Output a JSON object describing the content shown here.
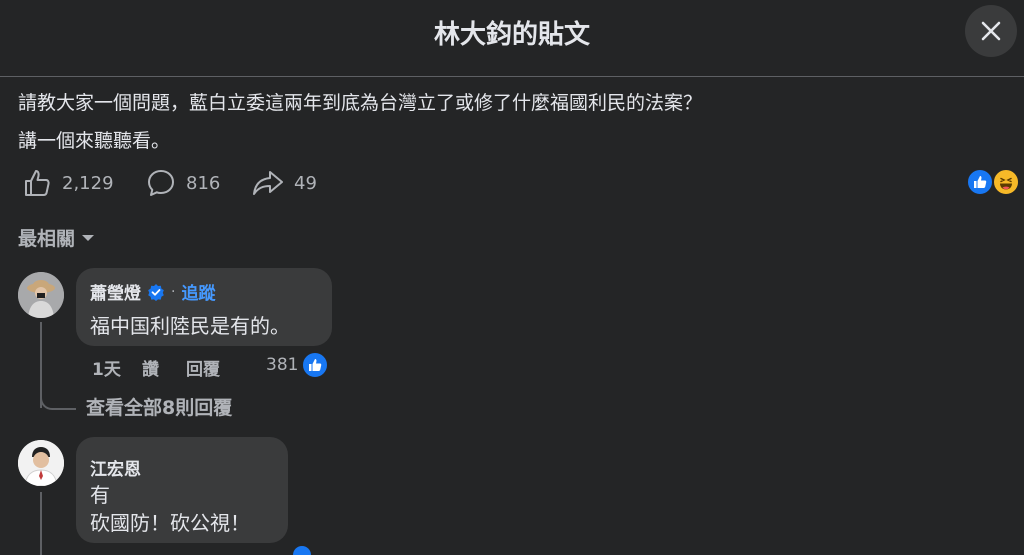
{
  "dialog": {
    "title": "林大鈞的貼文"
  },
  "post": {
    "line1": "請教大家一個問題，藍白立委這兩年到底為台灣立了或修了什麼福國利民的法案？",
    "line2": "講一個來聽聽看。",
    "likes": "2,129",
    "comments": "816",
    "shares": "49"
  },
  "sort": {
    "label": "最相關"
  },
  "comments": [
    {
      "author": "蕭瑩燈",
      "follow": "追蹤",
      "text": "福中国利陸民是有的。",
      "time": "1天",
      "like_label": "讚",
      "reply_label": "回覆",
      "reaction_count": "381",
      "view_replies": "查看全部8則回覆"
    },
    {
      "author": "江宏恩",
      "text_line1": "有",
      "text_line2": "砍國防！砍公視！"
    }
  ],
  "colors": {
    "accent": "#4599ff",
    "background": "#242526",
    "bubble": "#3a3b3c"
  }
}
